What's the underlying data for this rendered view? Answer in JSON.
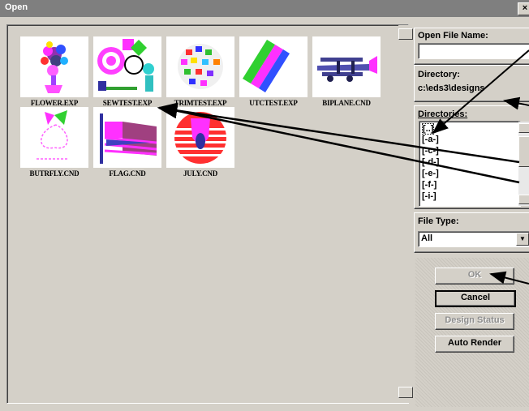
{
  "window": {
    "title": "Open",
    "close_glyph": "×"
  },
  "files": [
    {
      "name": "FLOWER.EXP"
    },
    {
      "name": "SEWTEST.EXP"
    },
    {
      "name": "TRIMTEST.EXP"
    },
    {
      "name": "UTCTEST.EXP"
    },
    {
      "name": "BIPLANE.CND"
    },
    {
      "name": "BUTRFLY.CND"
    },
    {
      "name": "FLAG.CND"
    },
    {
      "name": "JULY.CND"
    }
  ],
  "open_file_name": {
    "label": "Open File Name:",
    "value": ""
  },
  "directory": {
    "label": "Directory:",
    "value": "c:\\eds3\\designs"
  },
  "directories": {
    "label": "Directories:",
    "items": [
      "[..]",
      "[-a-]",
      "[-c-]",
      "[-d-]",
      "[-e-]",
      "[-f-]",
      "[-i-]"
    ]
  },
  "file_type": {
    "label": "File Type:",
    "value": "All"
  },
  "buttons": {
    "ok": "OK",
    "cancel": "Cancel",
    "design_status": "Design Status",
    "auto_render": "Auto Render"
  }
}
